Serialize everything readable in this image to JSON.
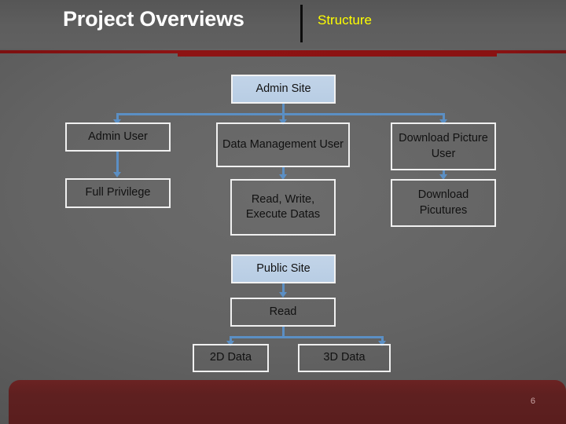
{
  "slide": {
    "title": "Project Overviews",
    "subtitle": "Structure",
    "page_number": "6",
    "colors": {
      "background": "#606060",
      "accent_red": "#8e1313",
      "footer_red": "#5e2020",
      "subtitle_yellow": "#ffff00",
      "node_fill_blue": "#bdd0e6",
      "connector_blue": "#5b8fc4",
      "node_border": "#ffffff",
      "node_text": "#111111"
    }
  },
  "diagram": {
    "type": "hierarchy-tree",
    "admin_branch": {
      "root": "Admin Site",
      "roles": [
        "Admin User",
        "Data Management User",
        "Download Picture User"
      ],
      "permissions": [
        "Full Privilege",
        "Read, Write, Execute Datas",
        "Download Picutures"
      ]
    },
    "public_branch": {
      "root": "Public Site",
      "permission": "Read",
      "data_types": [
        "2D Data",
        "3D Data"
      ]
    }
  }
}
